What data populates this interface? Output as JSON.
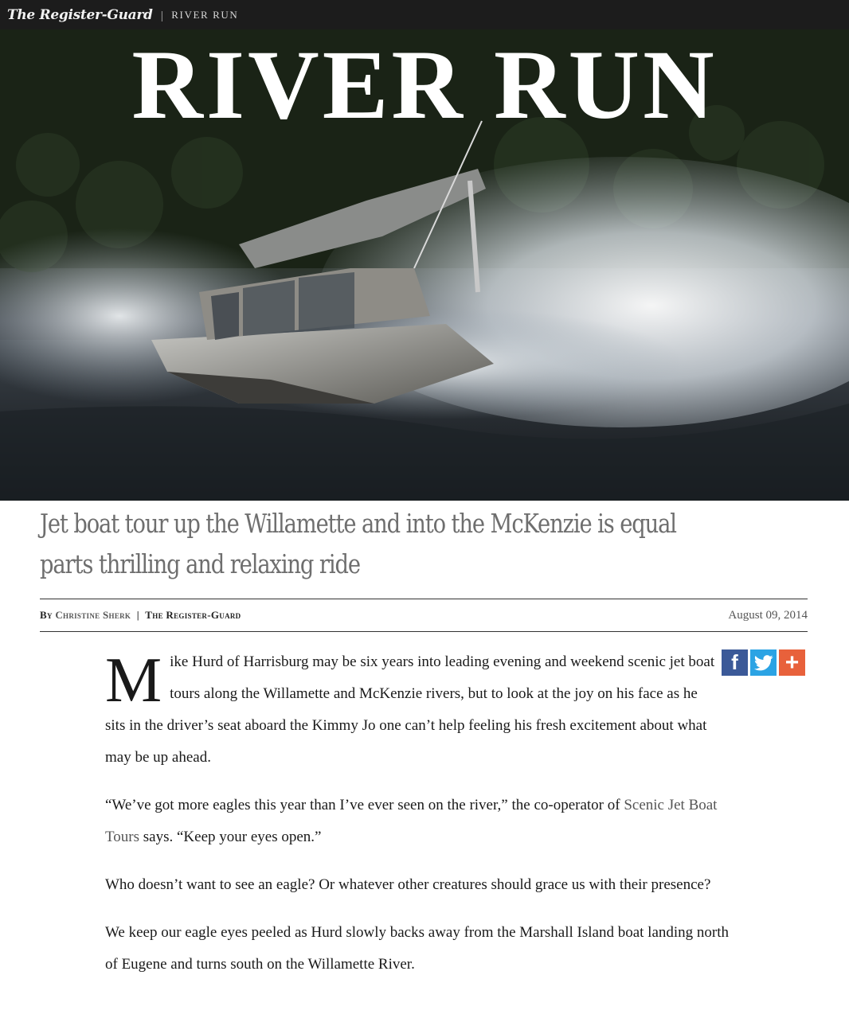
{
  "topbar": {
    "brand": "The Register-Guard",
    "separator": "|",
    "section": "RIVER RUN"
  },
  "hero": {
    "title": "RIVER RUN",
    "image_description_icon": "jet-boat-photo"
  },
  "headline": "Jet boat tour up the Willamette and into the McKenzie is equal parts thrilling and relaxing ride",
  "byline": {
    "prefix": "By",
    "author": "Christine Sherk",
    "divider": "|",
    "publication": "The Register-Guard",
    "date": "August 09, 2014"
  },
  "share": {
    "facebook_icon": "facebook-icon",
    "facebook_glyph": "f",
    "twitter_icon": "twitter-icon",
    "plus_icon": "plus-icon",
    "plus_glyph": "+",
    "colors": {
      "facebook": "#3b5998",
      "twitter": "#2ba3e4",
      "plus": "#e8613b"
    }
  },
  "article": {
    "dropcap": "M",
    "p1": "ike Hurd of Harrisburg may be six years into leading evening and weekend scenic jet boat tours along the Willamette and McKenzie rivers, but to look at the joy on his face as he sits in the driver’s seat aboard the Kimmy Jo one can’t help feeling his fresh excitement about what may be up ahead.",
    "p2_before": "“We’ve got more eagles this year than I’ve ever seen on the river,” the co-operator of ",
    "p2_link": "Scenic Jet Boat Tours",
    "p2_after": " says. “Keep your eyes open.”",
    "p3": "Who doesn’t want to see an eagle? Or whatever other creatures should grace us with their presence?",
    "p4": "We keep our eagle eyes peeled as Hurd slowly backs away from the Marshall Island boat landing north of Eugene and turns south on the Willamette River."
  }
}
